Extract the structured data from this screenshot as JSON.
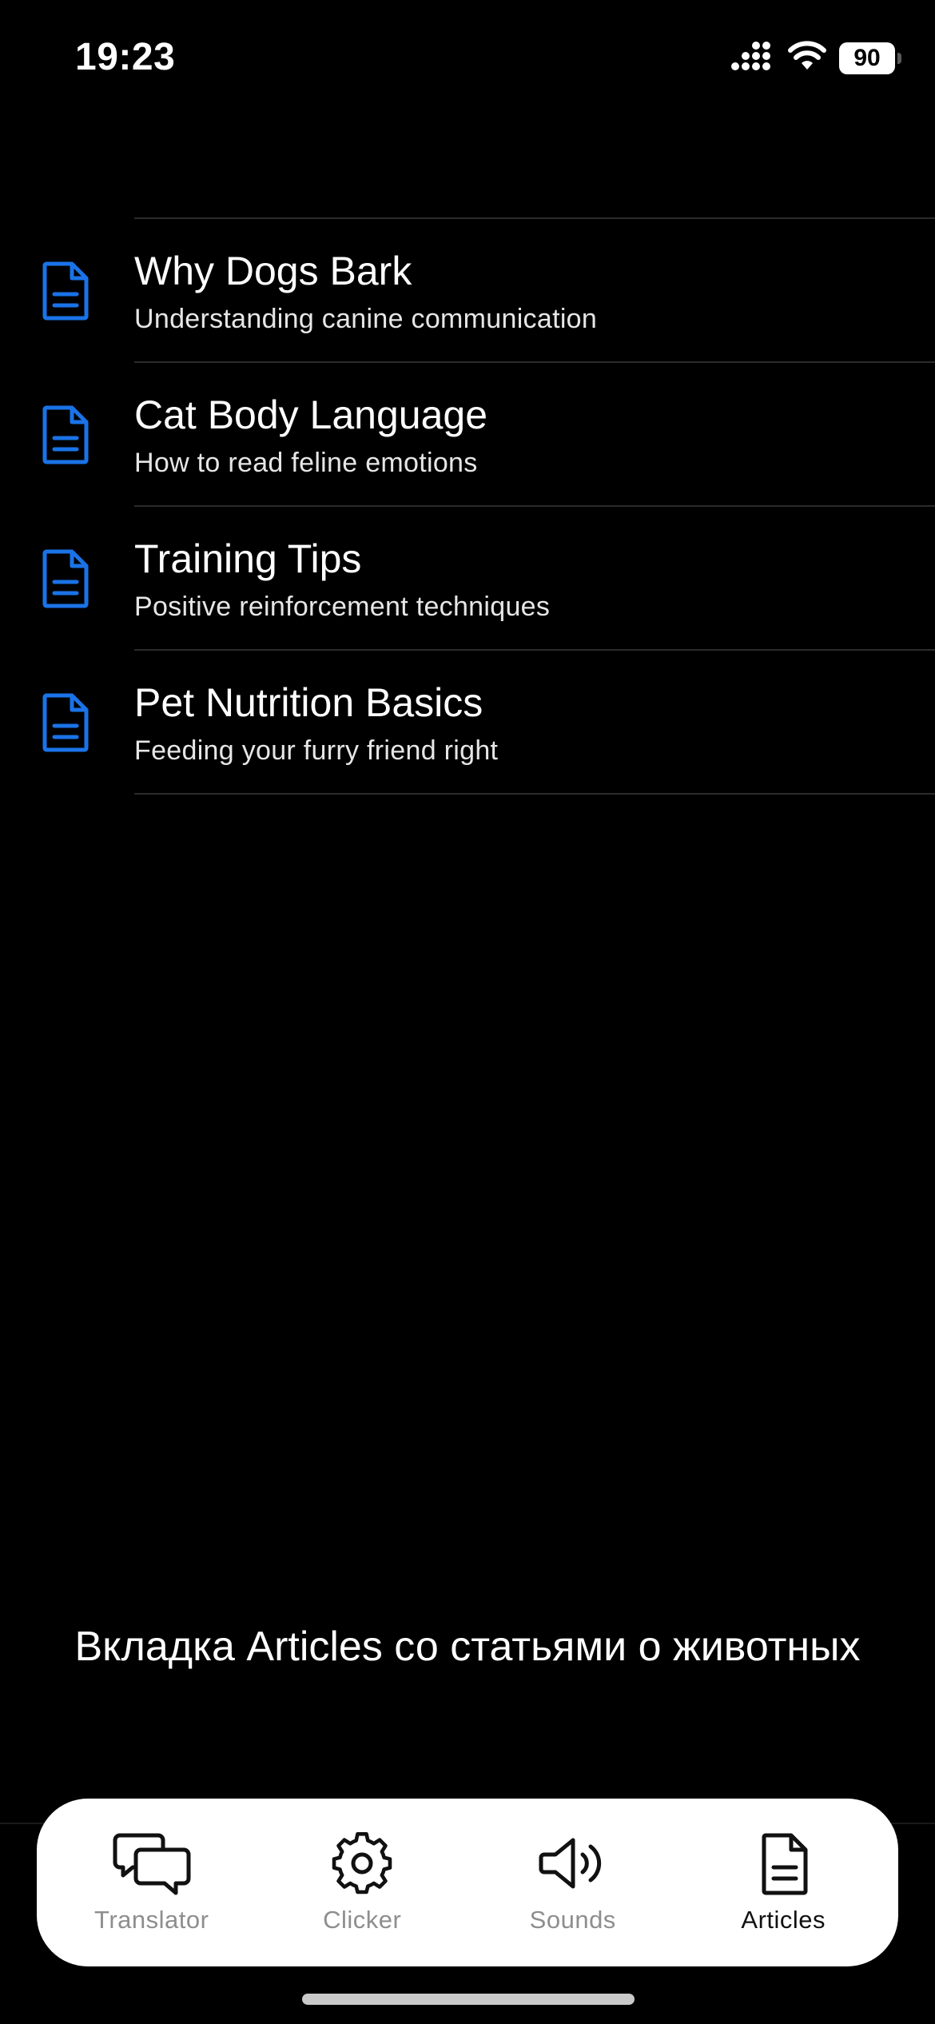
{
  "status_bar": {
    "time": "19:23",
    "battery": "90"
  },
  "articles": [
    {
      "title": "Why Dogs Bark",
      "subtitle": "Understanding canine communication",
      "icon": "document-icon"
    },
    {
      "title": "Cat Body Language",
      "subtitle": "How to read feline emotions",
      "icon": "document-icon"
    },
    {
      "title": "Training Tips",
      "subtitle": "Positive reinforcement techniques",
      "icon": "document-icon"
    },
    {
      "title": "Pet Nutrition Basics",
      "subtitle": "Feeding your furry friend right",
      "icon": "document-icon"
    }
  ],
  "caption": "Вкладка Articles со статьями о животных",
  "tabs": [
    {
      "label": "Translator",
      "icon": "chat-bubbles-icon",
      "active": false
    },
    {
      "label": "Clicker",
      "icon": "gear-icon",
      "active": false
    },
    {
      "label": "Sounds",
      "icon": "speaker-icon",
      "active": false
    },
    {
      "label": "Articles",
      "icon": "document-icon",
      "active": true
    }
  ],
  "colors": {
    "accent": "#1a73e8",
    "background": "#000000",
    "tab_bar": "#ffffff",
    "tab_inactive": "#8e8e8e"
  }
}
